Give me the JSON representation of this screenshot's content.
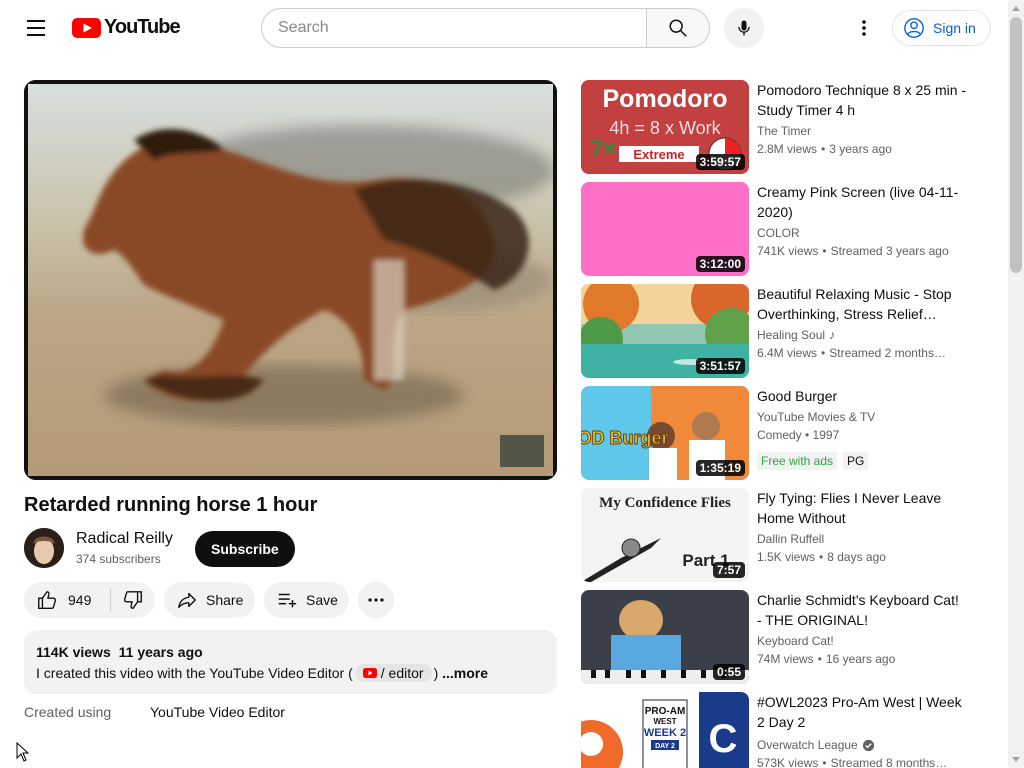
{
  "header": {
    "logo_text": "YouTube",
    "search_placeholder": "Search",
    "signin_label": "Sign in"
  },
  "video": {
    "title": "Retarded running horse 1 hour",
    "channel_name": "Radical Reilly",
    "subscribers": "374 subscribers",
    "subscribe_label": "Subscribe",
    "likes": "949",
    "share_label": "Share",
    "save_label": "Save"
  },
  "description": {
    "views": "114K views",
    "age": "11 years ago",
    "text_before": "I created this video with the YouTube Video Editor (",
    "chip_text": "/ editor",
    "text_after": ")",
    "more_label": "...more",
    "created_label": "Created using",
    "created_value": "YouTube Video Editor"
  },
  "recommendations": [
    {
      "title": "Pomodoro Technique 8 x 25 min - Study Timer 4 h",
      "channel": "The Timer",
      "views": "2.8M views",
      "age": "3 years ago",
      "duration": "3:59:57",
      "thumb_text": "Pomodoro",
      "thumb_sub": "4h = 8 x Work",
      "thumb_tag": "Extreme"
    },
    {
      "title": "Creamy Pink Screen (live 04-11-2020)",
      "channel": "COLOR",
      "views": "741K views",
      "age": "Streamed 3 years ago",
      "duration": "3:12:00"
    },
    {
      "title": "Beautiful Relaxing Music - Stop Overthinking, Stress Relief…",
      "channel": "Healing Soul",
      "views": "6.4M views",
      "age": "Streamed 2 months…",
      "duration": "3:51:57"
    },
    {
      "title": "Good Burger",
      "channel": "YouTube Movies & TV",
      "meta": "Comedy • 1997",
      "badge1": "Free with ads",
      "badge2": "PG",
      "duration": "1:35:19",
      "thumb_text": "GOOD Burger"
    },
    {
      "title": "Fly Tying: Flies I Never Leave Home Without",
      "channel": "Dallin Ruffell",
      "views": "1.5K views",
      "age": "8 days ago",
      "duration": "7:57",
      "thumb_text": "My Confidence Flies",
      "thumb_sub": "Part 1"
    },
    {
      "title": "Charlie Schmidt's Keyboard Cat! - THE ORIGINAL!",
      "channel": "Keyboard Cat!",
      "views": "74M views",
      "age": "16 years ago",
      "duration": "0:55"
    },
    {
      "title": "#OWL2023 Pro-Am West | Week 2 Day 2",
      "channel": "Overwatch League",
      "views": "573K views",
      "age": "Streamed 8 months…",
      "thumb_text": "PRO-AM",
      "thumb_sub": "WEST",
      "thumb_tag": "WEEK 2",
      "thumb_day": "DAY 2"
    }
  ],
  "colors": {
    "accent_red": "#ff0000",
    "link_blue": "#065fd4",
    "free_green": "#2ba640"
  }
}
